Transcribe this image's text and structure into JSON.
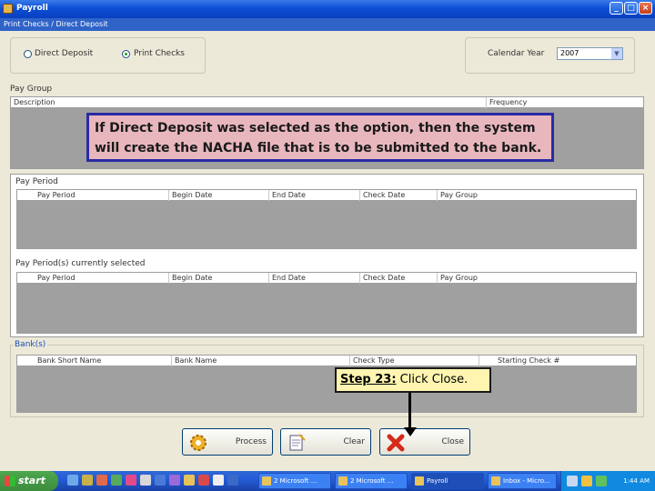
{
  "window": {
    "title": "Payroll",
    "menu": "Print Checks / Direct Deposit",
    "minimize": "_",
    "maximize": "□",
    "close": "×"
  },
  "options": {
    "direct_deposit": "Direct Deposit",
    "print_checks": "Print Checks",
    "selected": "Print Checks"
  },
  "calendar": {
    "label": "Calendar Year",
    "value": "2007"
  },
  "pay_group": {
    "label": "Pay Group",
    "columns": [
      "Description",
      "Frequency"
    ]
  },
  "pay_period": {
    "label": "Pay Period",
    "columns": [
      "Pay Period",
      "Begin Date",
      "End Date",
      "Check Date",
      "Pay Group"
    ]
  },
  "selected_periods": {
    "label": "Pay Period(s) currently selected",
    "columns": [
      "Pay Period",
      "Begin Date",
      "End Date",
      "Check Date",
      "Pay Group"
    ]
  },
  "banks": {
    "label": "Bank(s)",
    "columns": [
      "Bank Short Name",
      "Bank Name",
      "Check Type",
      "Starting Check #"
    ]
  },
  "callout": {
    "text": "If Direct Deposit was selected as the option, then the system will create the NACHA file that is to be submitted to the bank."
  },
  "step": {
    "number": "Step 23:",
    "text": " Click Close."
  },
  "buttons": {
    "process": "Process",
    "clear": "Clear",
    "close": "Close"
  },
  "taskbar": {
    "start": "start",
    "tasks": [
      "2 Microsoft ...",
      "2 Microsoft ...",
      "Payroll",
      "Inbox - Micro..."
    ],
    "clock": "1:44 AM"
  },
  "colors": {
    "titlebar": "#0c4fd6",
    "callout_bg": "#e8b7bd",
    "callout_border": "#2a2aa5",
    "grid_bg": "#a0a0a0",
    "taskbar": "#245dd7"
  }
}
